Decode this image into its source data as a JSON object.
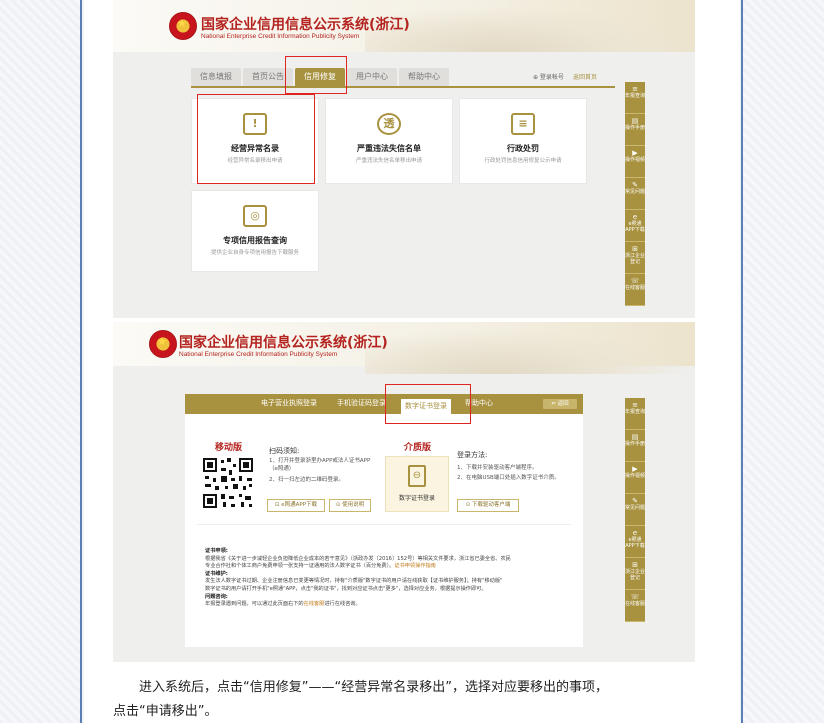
{
  "shot1": {
    "title": "国家企业信用信息公示系统(浙江)",
    "subtitle": "National Enterprise Credit Information Publicity System",
    "tabs": [
      "信息填报",
      "首页公告",
      "信用修复",
      "用户中心",
      "帮助中心"
    ],
    "active_tab": "信用修复",
    "login_links": [
      "⊕ 登录帐号",
      "返回首页"
    ],
    "cards": [
      {
        "title": "经营异常名录",
        "desc": "经营异常名录移出申请"
      },
      {
        "title": "严重违法失信名单",
        "desc": "严重违法失信名单移出申请"
      },
      {
        "title": "行政处罚",
        "desc": "行政处罚信息信用修复公示申请"
      },
      {
        "title": "专项信用报告查询",
        "desc": "提供企业自身专项信用报告下载服务"
      }
    ]
  },
  "toolbar": [
    {
      "icon": "≡",
      "label": "年报查询"
    },
    {
      "icon": "▤",
      "label": "操作手册"
    },
    {
      "icon": "▶",
      "label": "操作视频"
    },
    {
      "icon": "✎",
      "label": "常见问题"
    },
    {
      "icon": "e",
      "label": "e照通APP下载"
    },
    {
      "icon": "⊞",
      "label": "浙江企业登记"
    },
    {
      "icon": "☏",
      "label": "在线客服"
    }
  ],
  "shot2": {
    "title": "国家企业信用信息公示系统(浙江)",
    "subtitle": "National Enterprise Credit Information Publicity System",
    "tabs": [
      "电子营业执照登录",
      "手机验证码登录",
      "数字证书登录",
      "帮助中心"
    ],
    "active_tab": "数字证书登录",
    "back_label": "⇐ 返回",
    "mobile": {
      "heading": "移动版",
      "scan_title": "扫码须知:",
      "steps": [
        "1、打开并登录浙里办APP或法人证书APP（e照通）",
        "2、扫一扫左边的二维码登录。"
      ],
      "btn_download": "⊡ e照通APP下载",
      "btn_guide": "⊙ 使用说明"
    },
    "medium": {
      "heading": "介质版",
      "cert_label": "数字证书登录",
      "method_title": "登录方法:",
      "steps": [
        "1、下载并安装驱动客户端程序。",
        "2、在电脑USB端口处插入数字证书介质。"
      ],
      "btn_download": "⊙ 下载驱动客户端"
    },
    "notes": [
      {
        "head": "证书申领:"
      },
      {
        "text": "根据我省《关于进一步减轻企业负担降低企业成本的若干意见》（浙政办发〔2016〕152号）等相关文件要求，浙江省已委全省、农民"
      },
      {
        "text": "专业合作社和个体工商户免费申领一张支持一证通用的法人数字证书（百分免费）。",
        "link": "证书申领操作指南"
      },
      {
        "head": "证书维护:"
      },
      {
        "text": "发生法人数字证书过期、企业注册信息已变更等情况时，持有\"介质版\"数字证书的用户请在线获取【证书维护服务】；持有\"移动版\""
      },
      {
        "text": "数字证书的用户请打开手机\"e照通\"APP，点击\"我的证书\"，找到对应证书点击\"更多\"，选择对应业务，根据提示操作即可。"
      },
      {
        "head": "问题咨询:"
      },
      {
        "text": "年报登录遇到问题，可以通过此页面右下的",
        "link": "在线客服",
        "tail": "进行在线咨询。"
      }
    ]
  },
  "caption": {
    "line1": "进入系统后，点击“信用修复”——“经营异常名录移出”，选择对应要移出的事项，",
    "line2": "点击“申请移出”。"
  }
}
